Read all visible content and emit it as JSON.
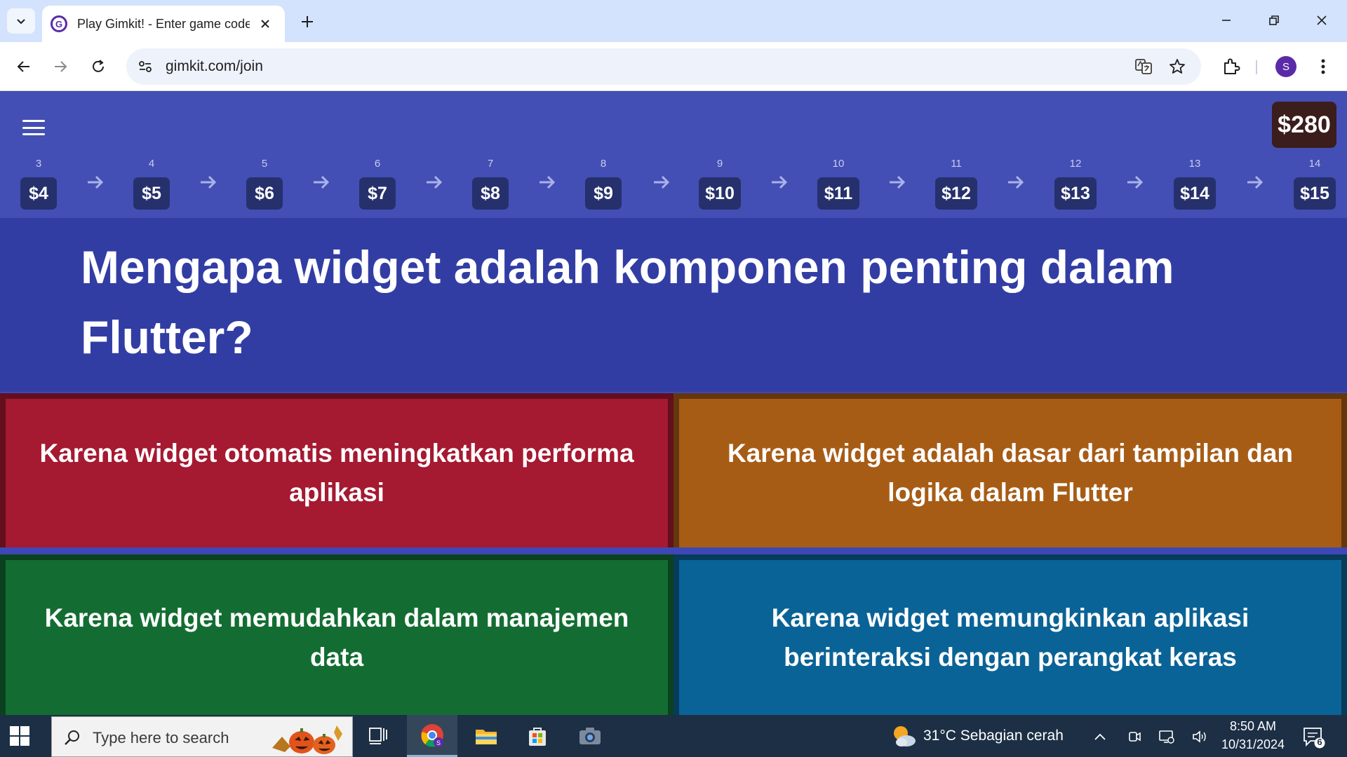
{
  "browser": {
    "tab_title": "Play Gimkit! - Enter game code",
    "favicon_letter": "G",
    "url": "gimkit.com/join",
    "profile_initial": "S"
  },
  "game": {
    "balance": "$280",
    "levels": [
      {
        "num": "3",
        "price": "$4"
      },
      {
        "num": "4",
        "price": "$5"
      },
      {
        "num": "5",
        "price": "$6"
      },
      {
        "num": "6",
        "price": "$7"
      },
      {
        "num": "7",
        "price": "$8"
      },
      {
        "num": "8",
        "price": "$9"
      },
      {
        "num": "9",
        "price": "$10"
      },
      {
        "num": "10",
        "price": "$11"
      },
      {
        "num": "11",
        "price": "$12"
      },
      {
        "num": "12",
        "price": "$13"
      },
      {
        "num": "13",
        "price": "$14"
      },
      {
        "num": "14",
        "price": "$15"
      }
    ],
    "question": "Mengapa widget adalah komponen penting dalam Flutter?",
    "answers": [
      {
        "text": "Karena widget otomatis meningkatkan performa aplikasi",
        "color": "#a51931"
      },
      {
        "text": "Karena widget adalah dasar dari tampilan dan logika dalam Flutter",
        "color": "#a75c16"
      },
      {
        "text": "Karena widget memudahkan dalam manajemen data",
        "color": "#136d32"
      },
      {
        "text": "Karena widget memungkinkan aplikasi berinteraksi dengan perangkat keras",
        "color": "#0a6396"
      }
    ]
  },
  "taskbar": {
    "search_placeholder": "Type here to search",
    "weather": "31°C  Sebagian cerah",
    "time": "8:50 AM",
    "date": "10/31/2024",
    "notification_count": "6"
  },
  "colors": {
    "page_bg": "#3d48b6",
    "question_band": "#323da4",
    "price_badge": "#26306c",
    "balance_bg": "#3b1d1d"
  }
}
